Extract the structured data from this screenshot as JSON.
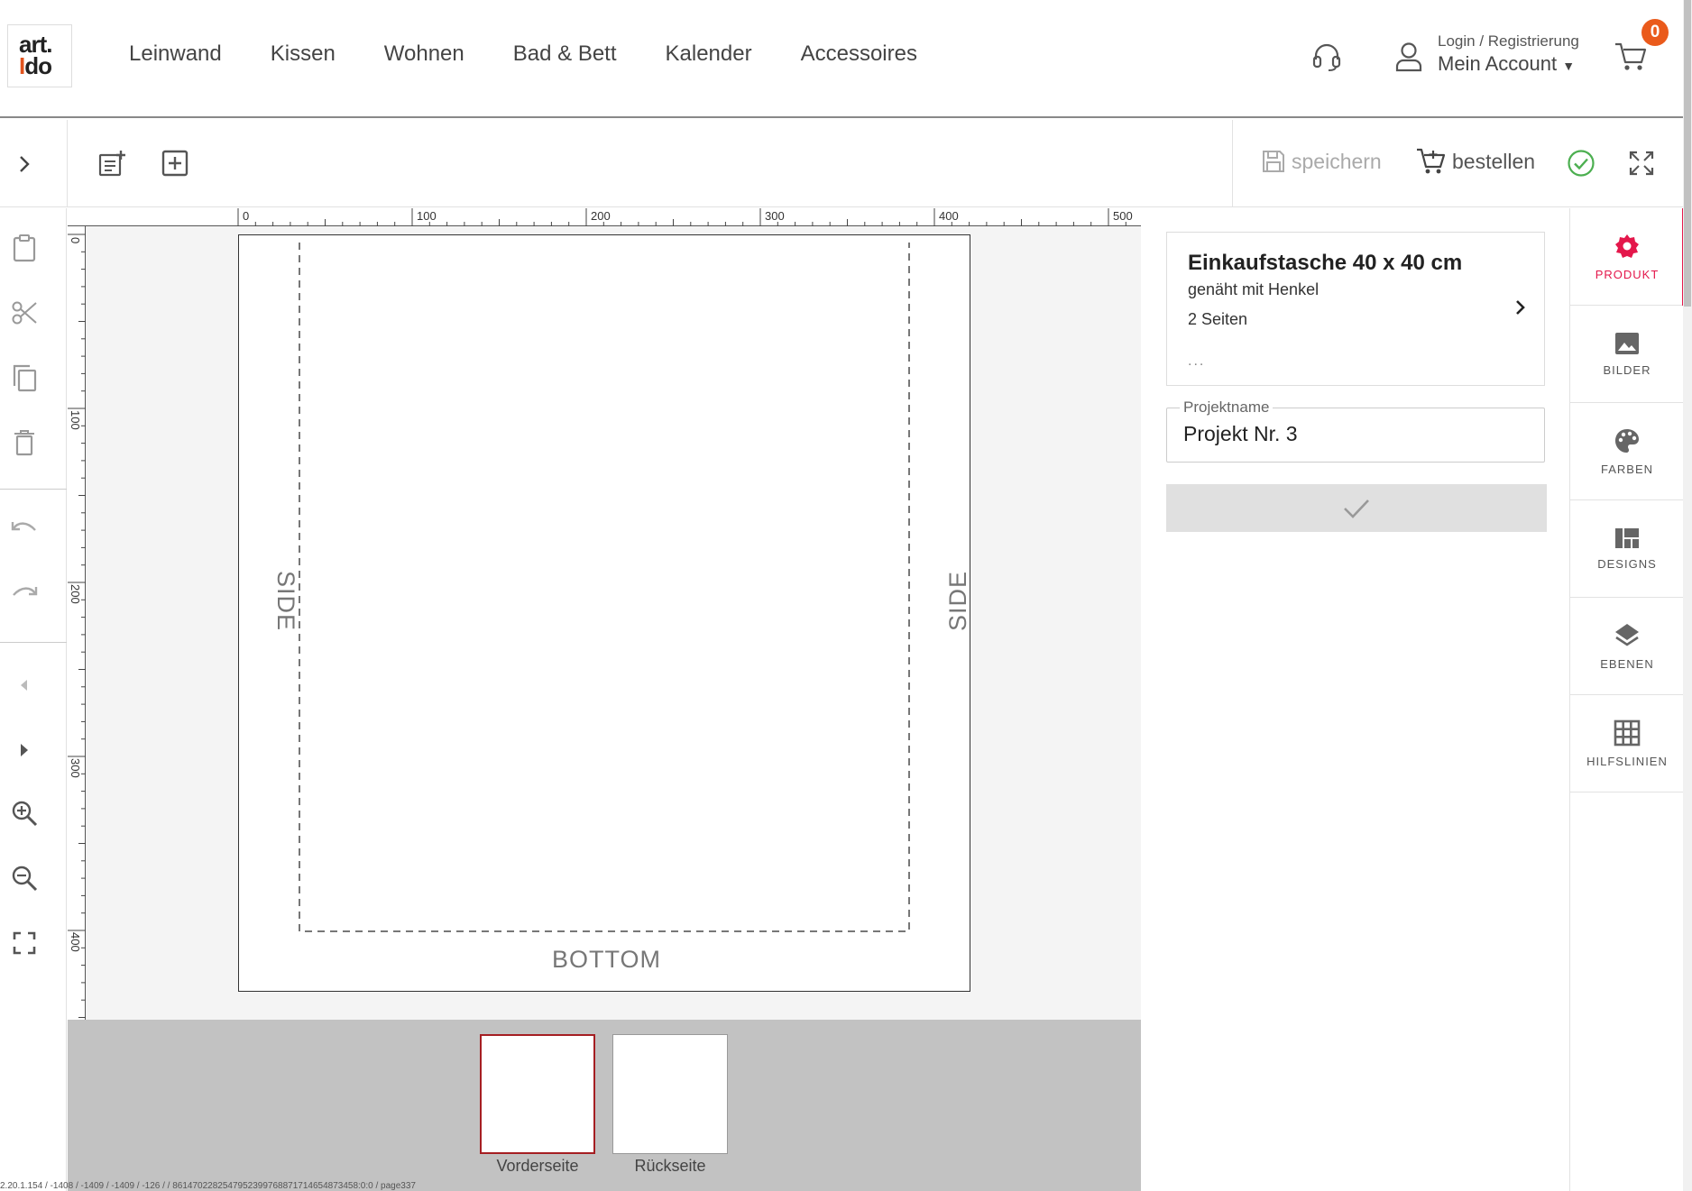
{
  "logo": {
    "line1": "art.",
    "line2_i": "I",
    "line2_rest": "do"
  },
  "nav": [
    "Leinwand",
    "Kissen",
    "Wohnen",
    "Bad & Bett",
    "Kalender",
    "Accessoires"
  ],
  "account": {
    "login": "Login / Registrierung",
    "name": "Mein Account"
  },
  "cart": {
    "count": "0"
  },
  "toolbar": {
    "save_label": "speichern",
    "order_label": "bestellen"
  },
  "ruler": {
    "h_ticks": [
      "0",
      "100",
      "200",
      "300",
      "400",
      "500"
    ],
    "v_ticks": [
      "0",
      "100",
      "200",
      "300",
      "400"
    ]
  },
  "canvas": {
    "side_left": "SIDE",
    "side_right": "SIDE",
    "bottom": "BOTTOM"
  },
  "pages": [
    {
      "label": "Vorderseite",
      "active": true
    },
    {
      "label": "Rückseite",
      "active": false
    }
  ],
  "debug": "2.20.1.154 / -1408 / -1409 / -1409 / -126 / / 8614702282547952399768871714654873458:0:0 / page337",
  "product": {
    "title": "Einkaufstasche 40 x 40 cm",
    "line1": "genäht mit Henkel",
    "line2": "2 Seiten",
    "ellipsis": "..."
  },
  "project": {
    "label": "Projektname",
    "value": "Projekt Nr. 3"
  },
  "tabs": [
    "PRODUKT",
    "BILDER",
    "FARBEN",
    "DESIGNS",
    "EBENEN",
    "HILFSLINIEN"
  ],
  "colors": {
    "accent": "#e4174b",
    "brand": "#e2541e",
    "badge": "#ea5a1b",
    "strip": "#c2c2c2",
    "active_page_border": "#a51e22",
    "ok_green": "#4caf50"
  }
}
